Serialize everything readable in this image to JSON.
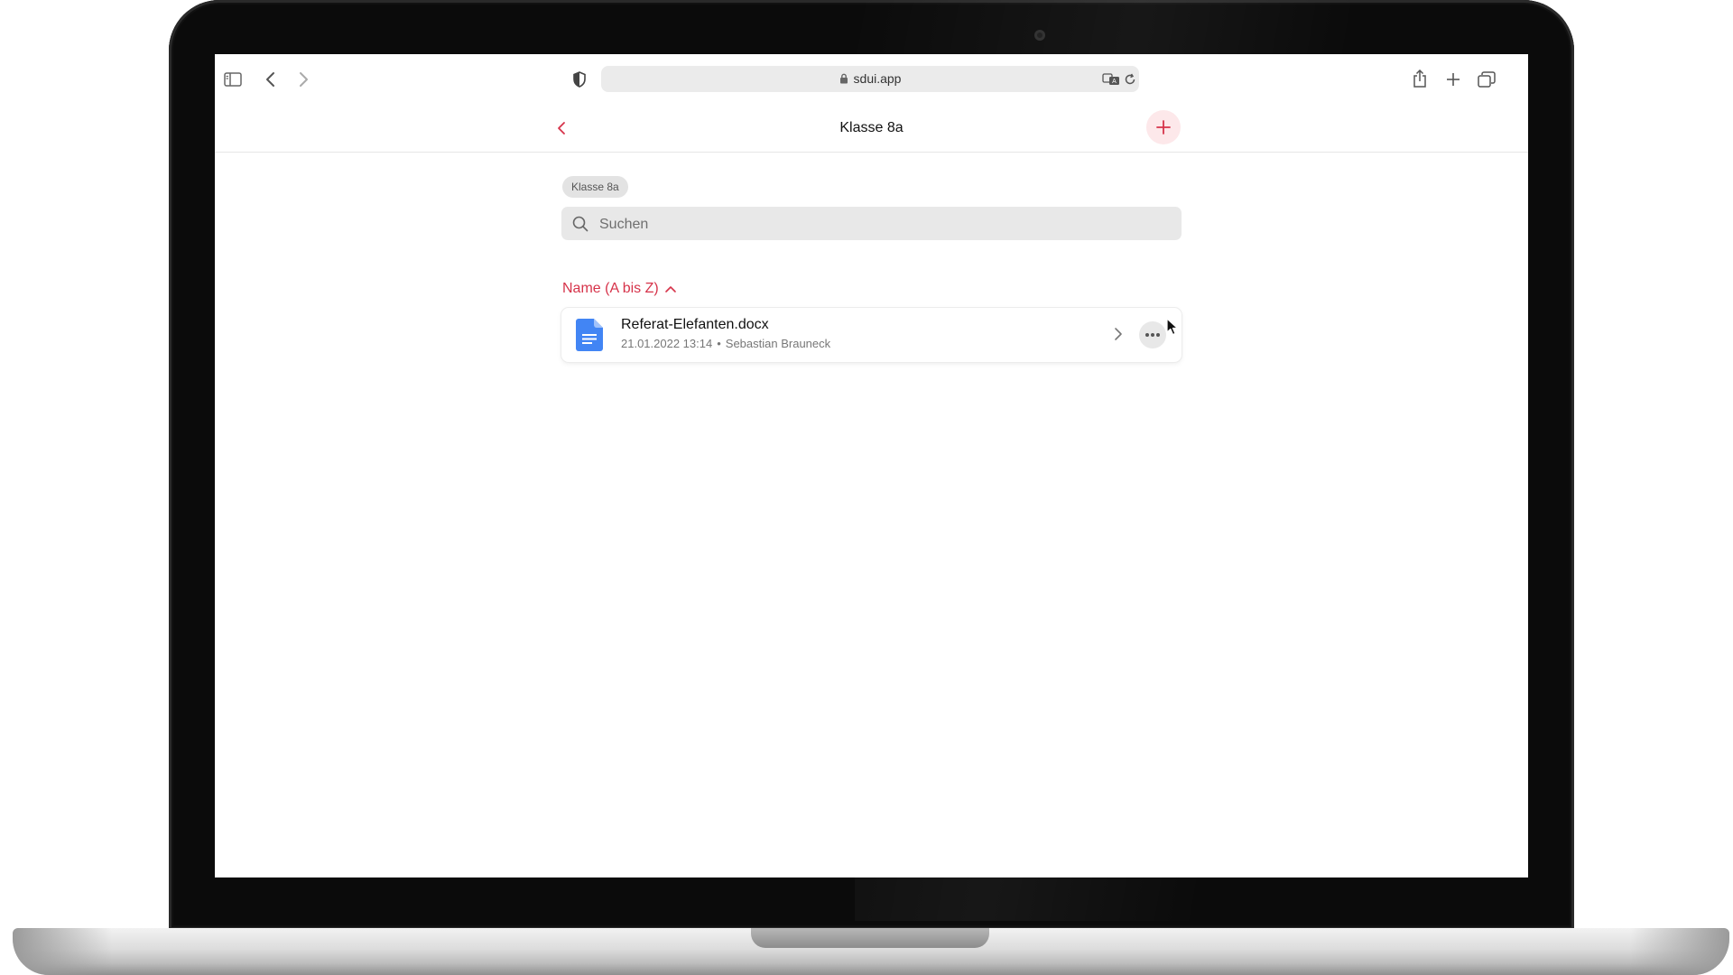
{
  "browser": {
    "url": "sdui.app"
  },
  "header": {
    "title": "Klasse 8a"
  },
  "breadcrumb": {
    "chip_label": "Klasse 8a"
  },
  "search": {
    "placeholder": "Suchen",
    "value": ""
  },
  "sort": {
    "label": "Name (A bis Z)"
  },
  "files": [
    {
      "name": "Referat-Elefanten.docx",
      "date": "21.01.2022 13:14",
      "separator": "•",
      "author": "Sebastian Brauneck",
      "icon": "document-icon"
    }
  ],
  "colors": {
    "accent": "#d6334a",
    "accent_bg": "#fde8ea",
    "doc_icon": "#4285f4"
  }
}
